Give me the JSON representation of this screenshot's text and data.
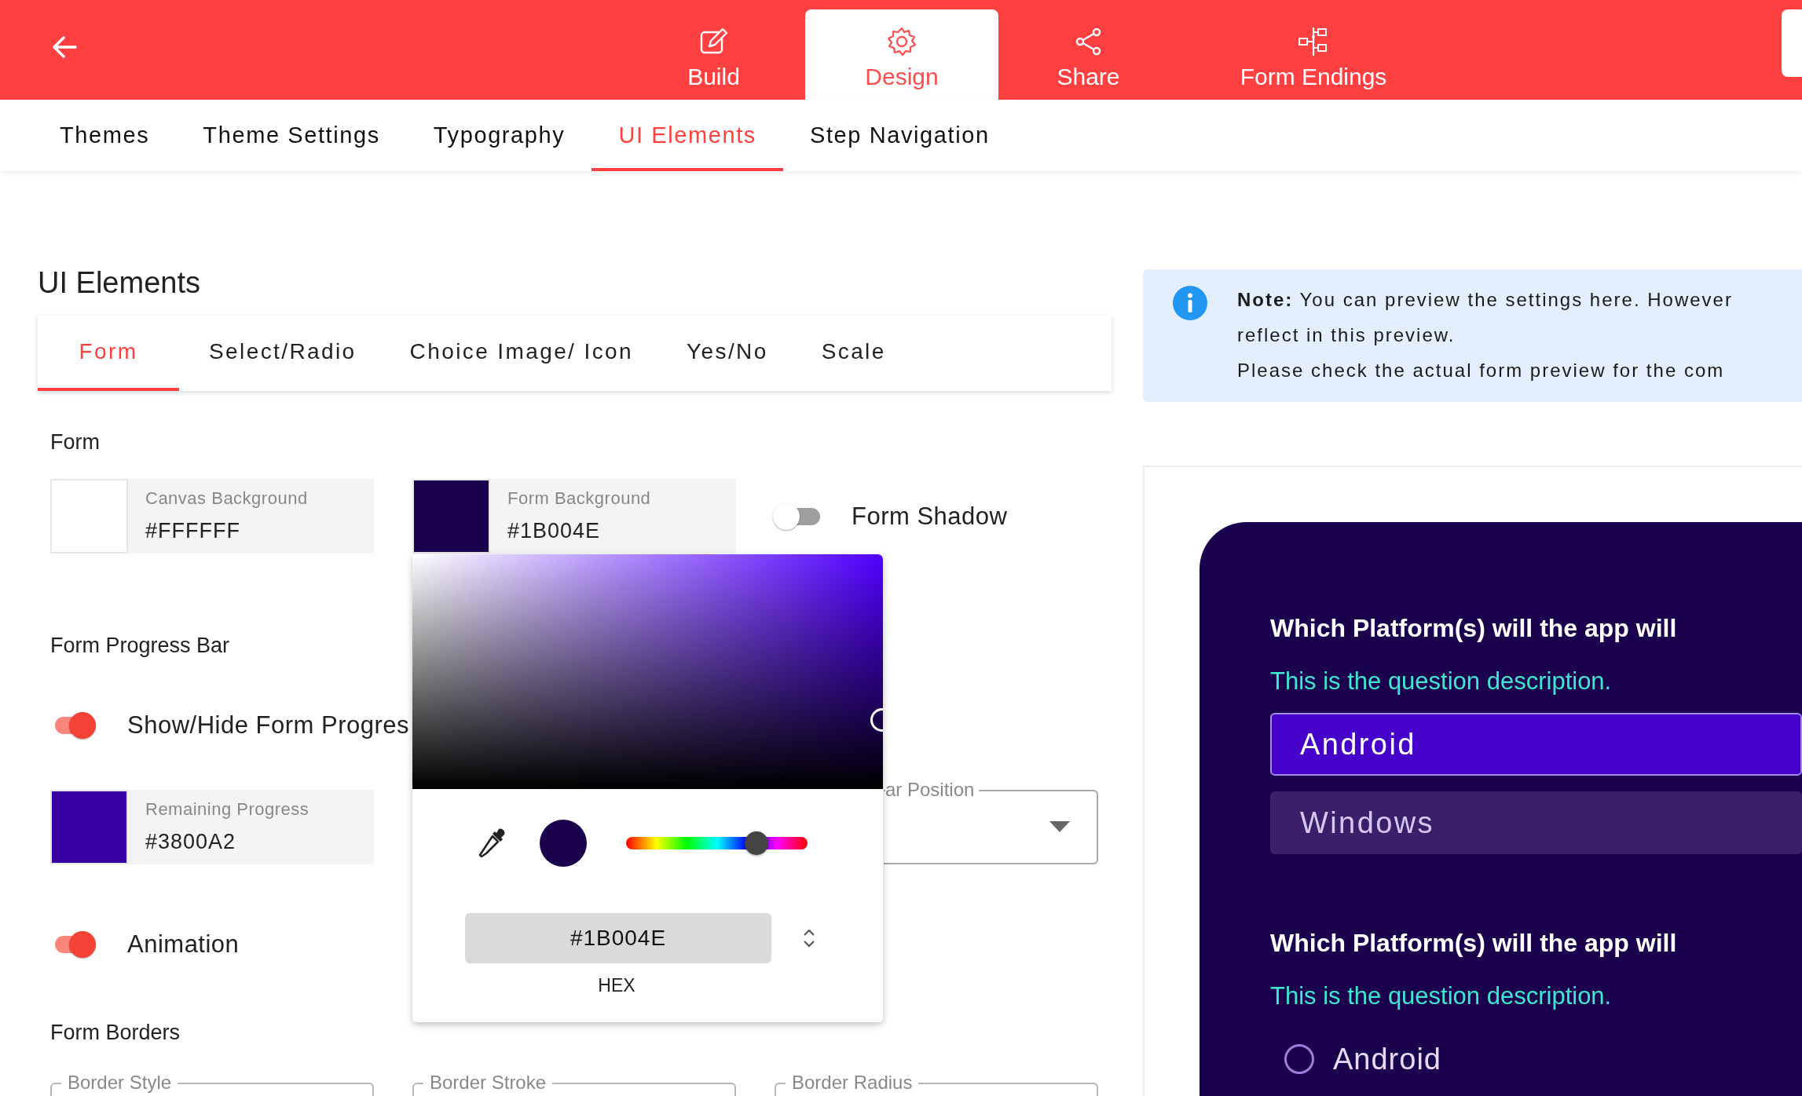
{
  "header": {
    "tabs": [
      {
        "label": "Build",
        "selected": false
      },
      {
        "label": "Design",
        "selected": true
      },
      {
        "label": "Share",
        "selected": false
      },
      {
        "label": "Form Endings",
        "selected": false
      }
    ]
  },
  "subtabs": [
    {
      "label": "Themes",
      "selected": false
    },
    {
      "label": "Theme Settings",
      "selected": false
    },
    {
      "label": "Typography",
      "selected": false
    },
    {
      "label": "UI Elements",
      "selected": true
    },
    {
      "label": "Step Navigation",
      "selected": false
    }
  ],
  "panel": {
    "title": "UI Elements",
    "tabs": [
      {
        "label": "Form",
        "selected": true
      },
      {
        "label": "Select/Radio",
        "selected": false
      },
      {
        "label": "Choice Image/ Icon",
        "selected": false
      },
      {
        "label": "Yes/No",
        "selected": false
      },
      {
        "label": "Scale",
        "selected": false
      }
    ],
    "form": {
      "heading": "Form",
      "color_fields": [
        {
          "label": "Canvas Background",
          "value": "#FFFFFF",
          "color": "#ffffff"
        },
        {
          "label": "Form Background",
          "value": "#1B004E",
          "color": "#1b004e"
        }
      ],
      "shadow_toggle": {
        "label": "Form Shadow",
        "on": false
      }
    },
    "progress_bar": {
      "heading": "Form Progress Bar",
      "visibility_toggle": {
        "label": "Show/Hide Form Progres",
        "on": true
      },
      "remaining_progress": {
        "label": "Remaining Progress",
        "value": "#3800A2",
        "color": "#3800a2"
      },
      "bar_position": {
        "label": "ar Position"
      },
      "animation_toggle": {
        "label": "Animation",
        "on": true
      }
    },
    "borders": {
      "heading": "Form Borders",
      "fields": [
        {
          "label": "Border Style"
        },
        {
          "label": "Border Stroke"
        },
        {
          "label": "Border Radius"
        }
      ]
    }
  },
  "color_picker": {
    "color": "#1b004e",
    "hue": {
      "level": 0.72
    },
    "hex_value": "#1B004E",
    "format": "HEX"
  },
  "note": {
    "lines": [
      "**Note:** You can preview the settings here. However",
      "reflect in this preview.",
      "Please check the actual form preview for the com"
    ]
  },
  "preview": {
    "questions": [
      {
        "title": "Which Platform(s) will the app will",
        "description": "This is the question description.",
        "kind": "buttons",
        "options": [
          {
            "label": "Android",
            "selected": true
          },
          {
            "label": "Windows",
            "selected": false
          }
        ]
      },
      {
        "title": "Which Platform(s) will the app will",
        "description": "This is the question description.",
        "kind": "radio",
        "options": [
          {
            "label": "Android",
            "selected": false
          }
        ]
      }
    ]
  }
}
